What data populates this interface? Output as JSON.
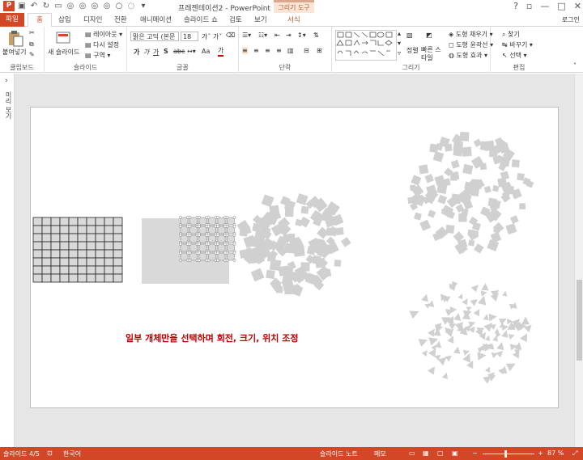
{
  "window": {
    "title": "프레젠테이션2 - PowerPoint",
    "context_tab": "그리기 도구",
    "login": "로그인"
  },
  "tabs": [
    "파일",
    "홈",
    "삽입",
    "디자인",
    "전환",
    "애니메이션",
    "슬라이드 쇼",
    "검토",
    "보기",
    "서식"
  ],
  "ribbon": {
    "clipboard": {
      "paste": "붙여넣기",
      "label": "클립보드"
    },
    "slides": {
      "new_slide": "새 슬라이드",
      "layout": "레이아웃",
      "reset": "다시 설정",
      "section": "구역",
      "label": "슬라이드"
    },
    "font": {
      "name": "맑은 고딕 (본문",
      "size": "18",
      "bold": "가",
      "italic": "가",
      "underline": "가",
      "strike": "S",
      "spacing": "abc",
      "case": "Aa",
      "label": "글꼴"
    },
    "paragraph": {
      "label": "단락"
    },
    "drawing": {
      "arrange": "정렬",
      "quick_styles": "빠른 스타일",
      "fill": "도형 채우기",
      "outline": "도형 윤곽선",
      "effects": "도형 효과",
      "label": "그리기"
    },
    "editing": {
      "find": "찾기",
      "replace": "바꾸기",
      "select": "선택",
      "label": "편집"
    }
  },
  "sidebar": {
    "label": "미리 보기"
  },
  "slide": {
    "caption": "일부 개체만을 선택하며 회전, 크기, 위치 조정"
  },
  "status": {
    "slide": "슬라이드 4/5",
    "language": "한국어",
    "notes": "슬라이드 노트",
    "comments": "메모",
    "zoom": "87 %"
  }
}
